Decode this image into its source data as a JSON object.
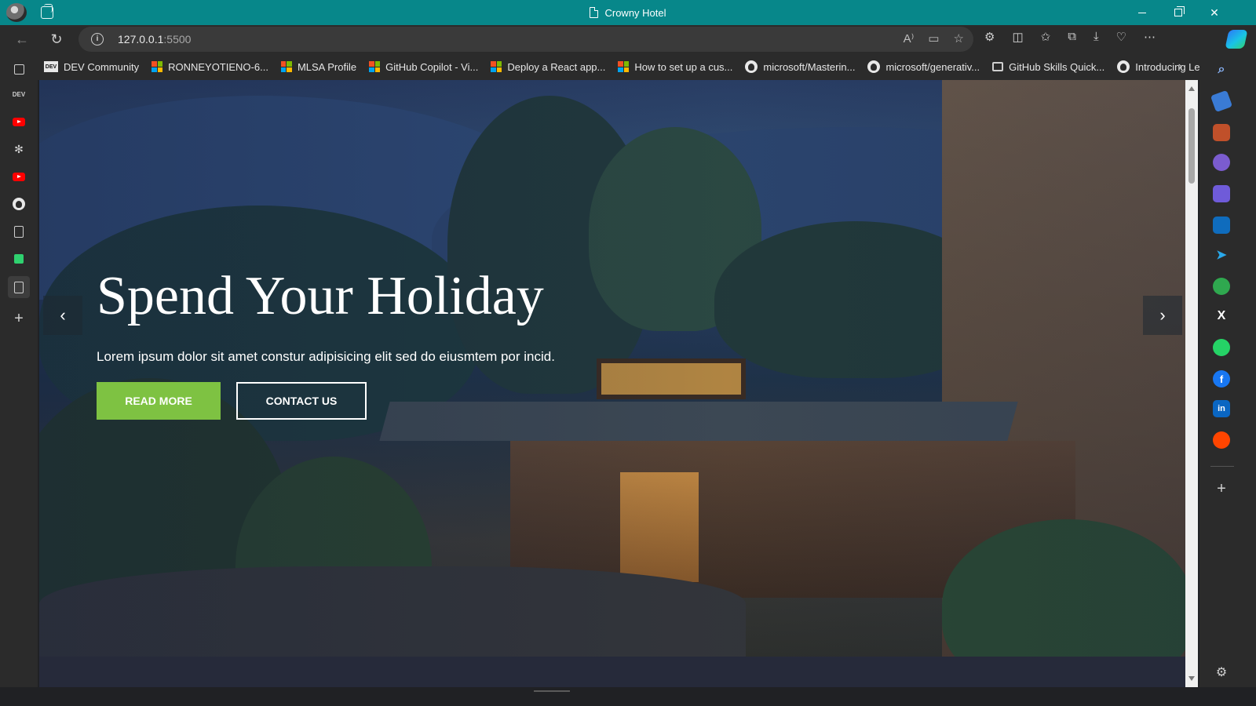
{
  "window": {
    "title": "Crowny Hotel"
  },
  "browser": {
    "url_host": "127.0.0.1",
    "url_port": ":5500"
  },
  "bookmarks": [
    {
      "label": "DEV Community",
      "icon": "dev-icon"
    },
    {
      "label": "RONNEYOTIENO-6...",
      "icon": "microsoft-icon"
    },
    {
      "label": "MLSA Profile",
      "icon": "microsoft-icon"
    },
    {
      "label": "GitHub Copilot - Vi...",
      "icon": "microsoft-icon"
    },
    {
      "label": "Deploy a React app...",
      "icon": "microsoft-icon"
    },
    {
      "label": "How to set up a cus...",
      "icon": "microsoft-icon"
    },
    {
      "label": "microsoft/Masterin...",
      "icon": "github-icon"
    },
    {
      "label": "microsoft/generativ...",
      "icon": "github-icon"
    },
    {
      "label": "GitHub Skills Quick...",
      "icon": "skills-icon"
    },
    {
      "label": "Introducing Learnin...",
      "icon": "github-icon"
    }
  ],
  "hero": {
    "title": "Spend Your Holiday",
    "subtitle": "Lorem ipsum dolor sit amet constur adipisicing elit sed do eiusmtem por incid.",
    "primary_button": "READ MORE",
    "secondary_button": "CONTACT US"
  },
  "left_sidebar": {
    "dev_label": "DEV"
  },
  "right_sidebar": {
    "twitter_glyph": "X",
    "linkedin_glyph": "in",
    "facebook_glyph": "f"
  },
  "colors": {
    "titlebar": "#07878a",
    "accent_green": "#7ec242"
  }
}
